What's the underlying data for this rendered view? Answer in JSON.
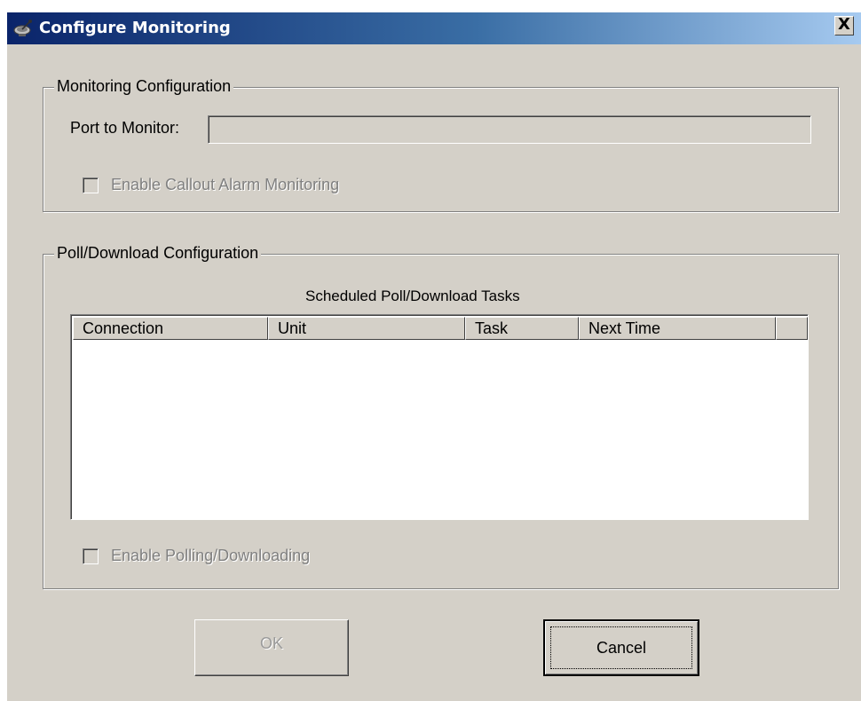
{
  "window": {
    "title": "Configure Monitoring",
    "close_symbol": "X",
    "icon": "satellite-dish-icon"
  },
  "monitoring": {
    "group_label": "Monitoring Configuration",
    "port_label": "Port to Monitor:",
    "port_value": "",
    "callout_checkbox_label": "Enable Callout Alarm Monitoring",
    "callout_checked": false
  },
  "poll": {
    "group_label": "Poll/Download Configuration",
    "list_caption": "Scheduled Poll/Download Tasks",
    "columns": [
      "Connection",
      "Unit",
      "Task",
      "Next Time",
      ""
    ],
    "rows": [],
    "polling_checkbox_label": "Enable Polling/Downloading",
    "polling_checked": false
  },
  "buttons": {
    "ok_label": "OK",
    "cancel_label": "Cancel"
  },
  "colors": {
    "dialog_background": "#d4d0c8",
    "titlebar_start": "#0a246a",
    "titlebar_end": "#a6caf0"
  }
}
